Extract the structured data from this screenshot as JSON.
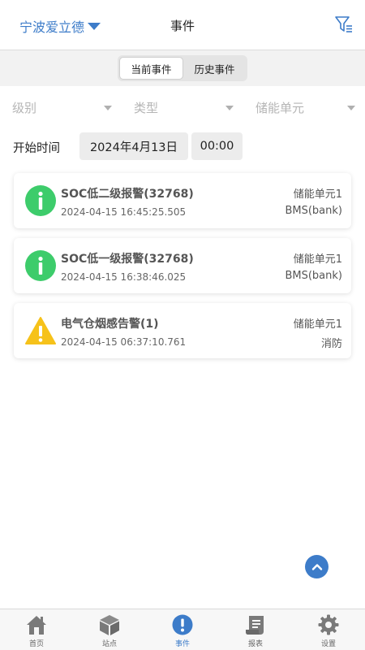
{
  "header": {
    "site_name": "宁波爱立德",
    "title": "事件",
    "filter_icon": "filter-icon"
  },
  "segment": {
    "tabs": [
      "当前事件",
      "历史事件"
    ],
    "active_index": 0
  },
  "filters": {
    "level_placeholder": "级别",
    "type_placeholder": "类型",
    "unit_placeholder": "储能单元"
  },
  "start_time": {
    "label": "开始时间",
    "date": "2024年4月13日",
    "time": "00:00"
  },
  "events": [
    {
      "icon": "info-icon",
      "title": "SOC低二级报警(32768)",
      "timestamp": "2024-04-15 16:45:25.505",
      "unit": "储能单元1",
      "source": "BMS(bank)"
    },
    {
      "icon": "info-icon",
      "title": "SOC低一级报警(32768)",
      "timestamp": "2024-04-15 16:38:46.025",
      "unit": "储能单元1",
      "source": "BMS(bank)"
    },
    {
      "icon": "warning-icon",
      "title": "电气仓烟感告警(1)",
      "timestamp": "2024-04-15 06:37:10.761",
      "unit": "储能单元1",
      "source": "消防"
    }
  ],
  "tabbar": {
    "items": [
      {
        "label": "首页",
        "icon": "home-icon"
      },
      {
        "label": "站点",
        "icon": "cube-icon"
      },
      {
        "label": "事件",
        "icon": "alert-icon"
      },
      {
        "label": "报表",
        "icon": "report-icon"
      },
      {
        "label": "设置",
        "icon": "gear-icon"
      }
    ],
    "active_index": 2
  },
  "colors": {
    "accent": "#3d7cc9",
    "info_green": "#3dcc6b",
    "warning_yellow": "#f6c21a"
  }
}
